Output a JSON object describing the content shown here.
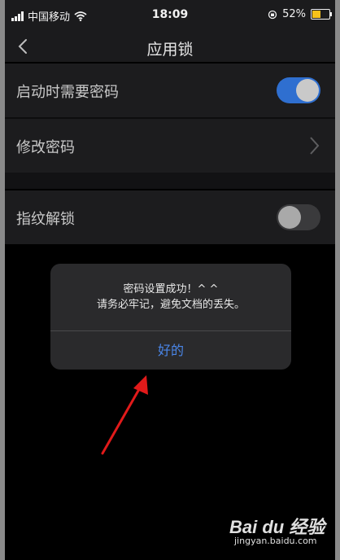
{
  "status_bar": {
    "carrier": "中国移动",
    "time": "18:09",
    "battery_percent": "52%",
    "battery_level": 0.52,
    "battery_color": "#f6c21a"
  },
  "nav": {
    "title": "应用锁",
    "back_icon": "chevron-left-icon"
  },
  "settings": {
    "require_password_on_launch": {
      "label": "启动时需要密码",
      "enabled": true
    },
    "change_password": {
      "label": "修改密码"
    },
    "fingerprint_unlock": {
      "label": "指纹解锁",
      "enabled": false
    }
  },
  "alert": {
    "line1": "密码设置成功！^ ^",
    "line2": "请务必牢记，避免文档的丢失。",
    "ok_label": "好的"
  },
  "watermark": {
    "logo_text": "Bai du 经验",
    "site": "jingyan.baidu.com"
  },
  "colors": {
    "accent": "#2f6fd0",
    "alert_button": "#4a86e8",
    "annotation_arrow": "#e11a1a"
  }
}
